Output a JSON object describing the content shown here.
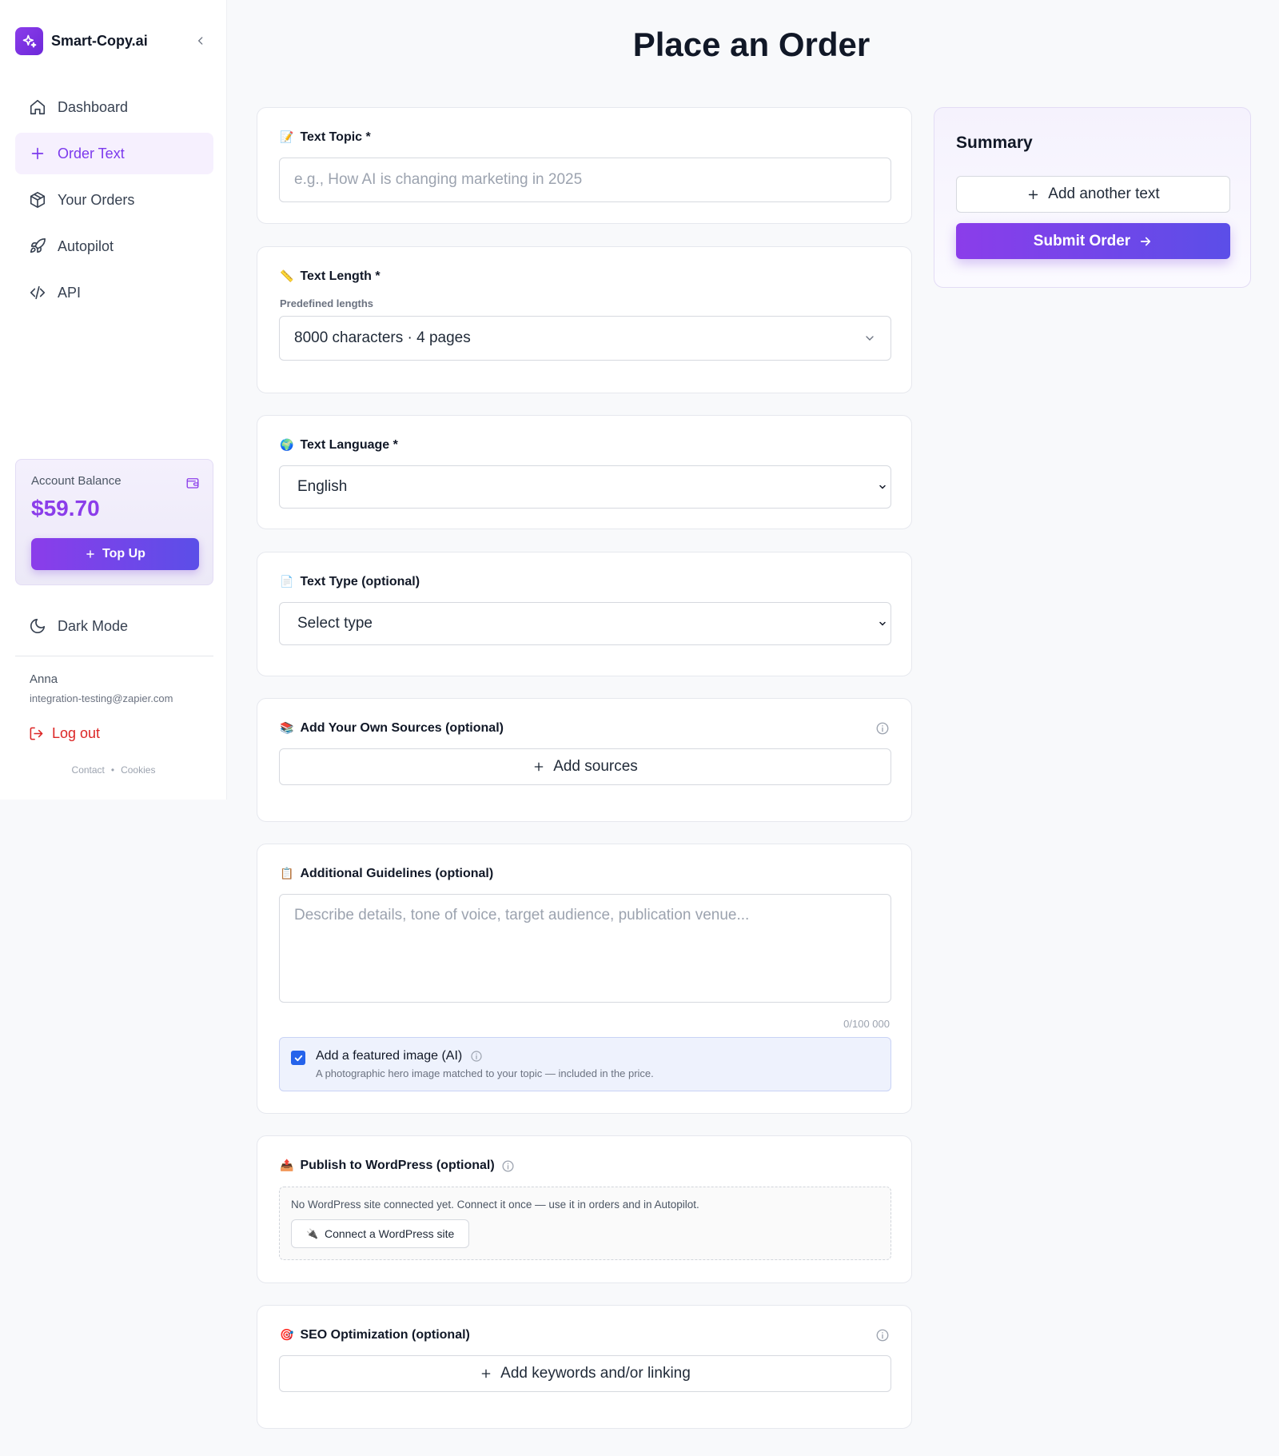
{
  "brand": {
    "name": "Smart-Copy.ai"
  },
  "sidebar": {
    "items": [
      {
        "label": "Dashboard",
        "icon": "home-icon"
      },
      {
        "label": "Order Text",
        "icon": "plus-icon",
        "active": true
      },
      {
        "label": "Your Orders",
        "icon": "package-icon"
      },
      {
        "label": "Autopilot",
        "icon": "rocket-icon"
      },
      {
        "label": "API",
        "icon": "code-icon"
      }
    ],
    "balance": {
      "label": "Account Balance",
      "amount": "$59.70",
      "topup_label": "Top Up"
    },
    "dark_mode_label": "Dark Mode",
    "user": {
      "name": "Anna",
      "email": "integration-testing@zapier.com"
    },
    "logout_label": "Log out",
    "footer": {
      "contact": "Contact",
      "cookies": "Cookies"
    }
  },
  "main": {
    "title": "Place an Order",
    "topic": {
      "label": "Text Topic *",
      "placeholder": "e.g., How AI is changing marketing in 2025"
    },
    "length": {
      "label": "Text Length *",
      "sublabel": "Predefined lengths",
      "value": "8000 characters · 4 pages"
    },
    "language": {
      "label": "Text Language *",
      "value": "English"
    },
    "type": {
      "label": "Text Type (optional)",
      "value": "Select type"
    },
    "sources": {
      "label": "Add Your Own Sources (optional)",
      "button": "Add sources"
    },
    "guidelines": {
      "label": "Additional Guidelines (optional)",
      "placeholder": "Describe details, tone of voice, target audience, publication venue...",
      "counter": "0/100 000",
      "image_title": "Add a featured image (AI)",
      "image_desc": "A photographic hero image matched to your topic — included in the price.",
      "image_checked": true
    },
    "wordpress": {
      "label": "Publish to WordPress (optional)",
      "text": "No WordPress site connected yet. Connect it once — use it in orders and in Autopilot.",
      "button": "Connect a WordPress site"
    },
    "seo": {
      "label": "SEO Optimization (optional)",
      "button": "Add keywords and/or linking"
    }
  },
  "summary": {
    "title": "Summary",
    "add_label": "Add another text",
    "submit_label": "Submit Order"
  },
  "colors": {
    "accent": "#8b3dea",
    "accent2": "#5b4ee8",
    "danger": "#dc2626",
    "checkbox": "#2563eb"
  }
}
